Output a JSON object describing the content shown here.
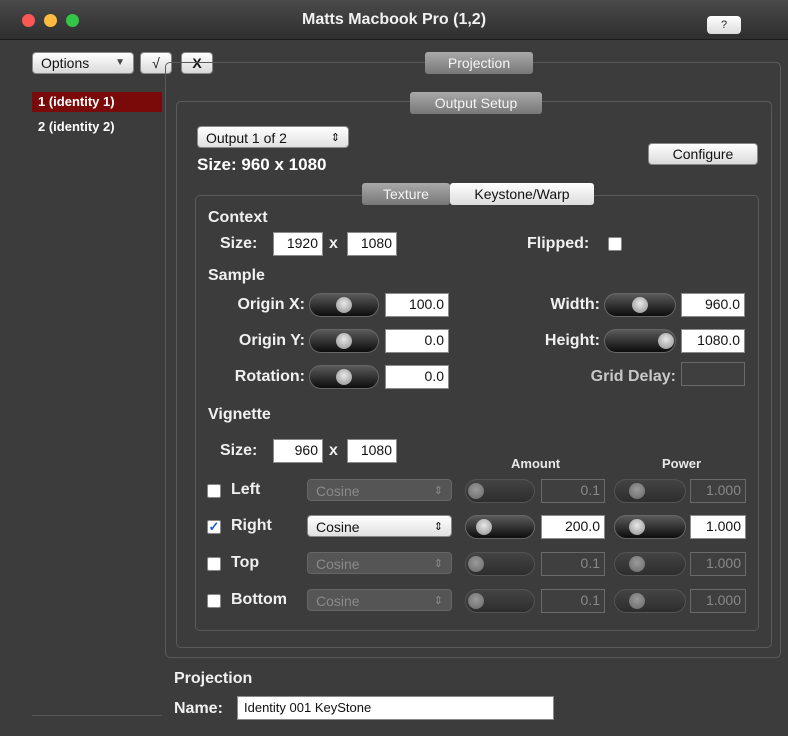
{
  "window": {
    "title": "Matts Macbook Pro (1,2)",
    "help_label": "?",
    "traffic_lights": {
      "close": "#fc5753",
      "minimize": "#fdbc40",
      "zoom": "#33c748"
    }
  },
  "toolbar": {
    "options_label": "Options",
    "options_arrow": "▼",
    "check_label": "√",
    "x_label": "X"
  },
  "sidebar": {
    "items": [
      {
        "label": "1 (identity 1)",
        "selected": true
      },
      {
        "label": "2 (identity 2)",
        "selected": false
      }
    ]
  },
  "projection_header": "Projection",
  "output_setup": {
    "header": "Output Setup",
    "output_select": "Output 1 of 2",
    "size_text": "Size: 960 x 1080",
    "configure_label": "Configure"
  },
  "tabs": [
    {
      "label": "Texture",
      "selected": true
    },
    {
      "label": "Keystone/Warp",
      "selected": false
    }
  ],
  "context": {
    "title": "Context",
    "size_label": "Size:",
    "width": "1920",
    "x_sep": "x",
    "height": "1080",
    "flipped_label": "Flipped:",
    "flipped": false
  },
  "sample": {
    "title": "Sample",
    "origin_x": {
      "label": "Origin X:",
      "value": "100.0",
      "slider_fraction": 0.43
    },
    "origin_y": {
      "label": "Origin Y:",
      "value": "0.0",
      "slider_fraction": 0.43
    },
    "rotation": {
      "label": "Rotation:",
      "value": "0.0",
      "slider_fraction": 0.43
    },
    "width": {
      "label": "Width:",
      "value": "960.0",
      "slider_fraction": 0.43
    },
    "height": {
      "label": "Height:",
      "value": "1080.0",
      "slider_fraction": 0.84
    },
    "grid_delay": {
      "label": "Grid Delay:",
      "value": ""
    }
  },
  "vignette": {
    "title": "Vignette",
    "size_label": "Size:",
    "width": "960",
    "x_sep": "x",
    "height": "1080",
    "amount_header": "Amount",
    "power_header": "Power",
    "rows": [
      {
        "label": "Left",
        "checked": false,
        "mode": "Cosine",
        "amount": "0.1",
        "power": "1.000",
        "enabled": false
      },
      {
        "label": "Right",
        "checked": true,
        "mode": "Cosine",
        "amount": "200.0",
        "power": "1.000",
        "enabled": true
      },
      {
        "label": "Top",
        "checked": false,
        "mode": "Cosine",
        "amount": "0.1",
        "power": "1.000",
        "enabled": false
      },
      {
        "label": "Bottom",
        "checked": false,
        "mode": "Cosine",
        "amount": "0.1",
        "power": "1.000",
        "enabled": false
      }
    ]
  },
  "projection_footer": {
    "title": "Projection",
    "name_label": "Name:",
    "name_value": "Identity 001 KeyStone"
  }
}
